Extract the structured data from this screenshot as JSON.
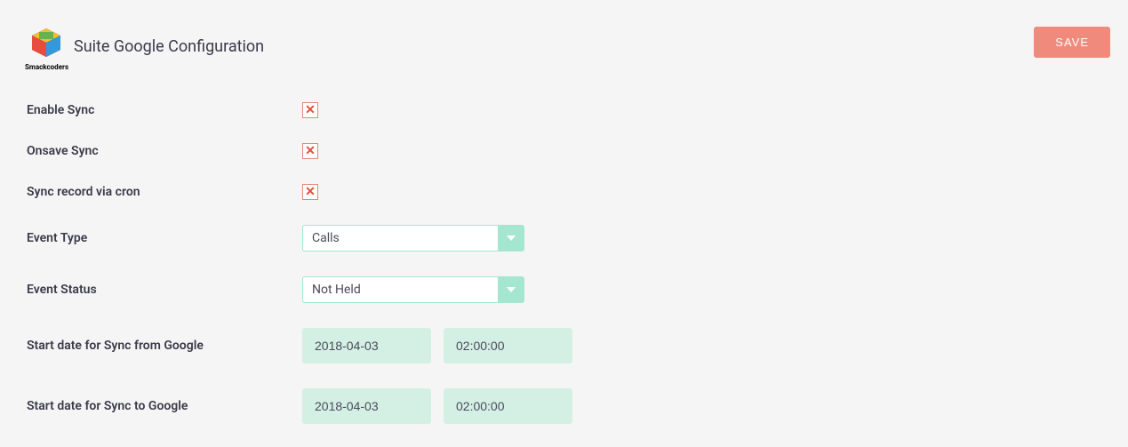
{
  "header": {
    "logo_text": "Smackcoders",
    "title": "Suite Google Configuration",
    "save_label": "SAVE"
  },
  "form": {
    "enable_sync": {
      "label": "Enable Sync",
      "checked": false
    },
    "onsave_sync": {
      "label": "Onsave Sync",
      "checked": false
    },
    "sync_record_cron": {
      "label": "Sync record via cron",
      "checked": false
    },
    "event_type": {
      "label": "Event Type",
      "value": "Calls"
    },
    "event_status": {
      "label": "Event Status",
      "value": "Not Held"
    },
    "start_from_google": {
      "label": "Start date for Sync from Google",
      "date": "2018-04-03",
      "time": "02:00:00"
    },
    "start_to_google": {
      "label": "Start date for Sync to Google",
      "date": "2018-04-03",
      "time": "02:00:00"
    }
  }
}
